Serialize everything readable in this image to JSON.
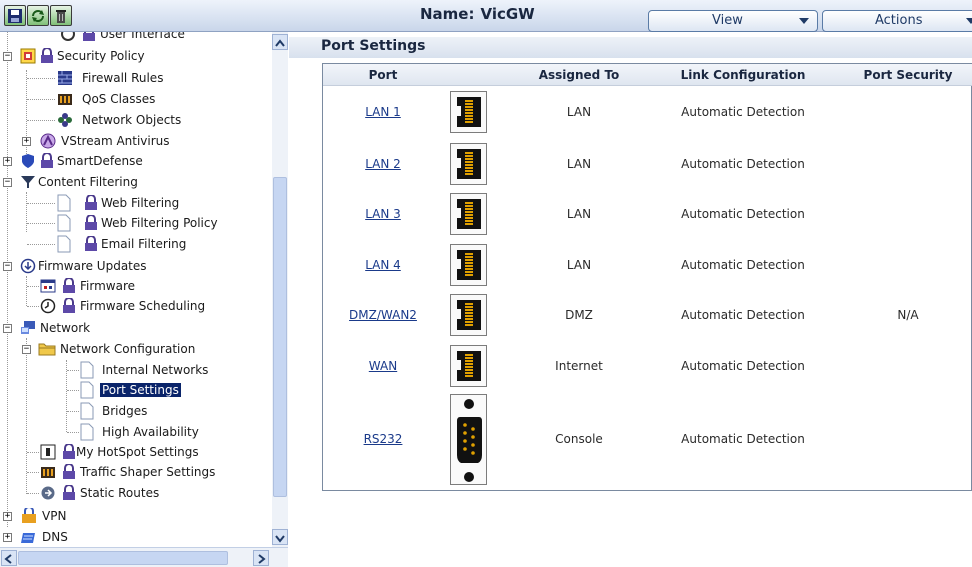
{
  "header": {
    "name_label": "Name:",
    "name_value": "VicGW",
    "view_label": "View",
    "actions_label": "Actions",
    "toolbar_icons": [
      "save-icon",
      "refresh-icon",
      "delete-icon"
    ]
  },
  "tree": {
    "items": [
      {
        "label": "User Interface",
        "icon": "user-interface-icon",
        "locked": true
      },
      {
        "label": "Security Policy",
        "icon": "security-policy-icon",
        "locked": true
      },
      {
        "label": "Firewall Rules",
        "icon": "firewall-icon",
        "locked": false
      },
      {
        "label": "QoS Classes",
        "icon": "qos-icon",
        "locked": false
      },
      {
        "label": "Network Objects",
        "icon": "network-objects-icon",
        "locked": false
      },
      {
        "label": "VStream Antivirus",
        "icon": "antivirus-icon",
        "locked": false
      },
      {
        "label": "SmartDefense",
        "icon": "shield-icon",
        "locked": true
      },
      {
        "label": "Content Filtering",
        "icon": "filter-icon",
        "locked": false
      },
      {
        "label": "Web Filtering",
        "icon": "page-icon",
        "locked": true
      },
      {
        "label": "Web Filtering Policy",
        "icon": "page-icon",
        "locked": true
      },
      {
        "label": "Email Filtering",
        "icon": "page-icon",
        "locked": true
      },
      {
        "label": "Firmware Updates",
        "icon": "download-icon",
        "locked": false
      },
      {
        "label": "Firmware",
        "icon": "firmware-icon",
        "locked": true
      },
      {
        "label": "Firmware Scheduling",
        "icon": "clock-icon",
        "locked": true
      },
      {
        "label": "Network",
        "icon": "network-icon",
        "locked": false
      },
      {
        "label": "Network Configuration",
        "icon": "folder-icon",
        "locked": false
      },
      {
        "label": "Internal Networks",
        "icon": "page-icon",
        "locked": false
      },
      {
        "label": "Port Settings",
        "icon": "page-icon",
        "locked": false,
        "selected": true
      },
      {
        "label": "Bridges",
        "icon": "page-icon",
        "locked": false
      },
      {
        "label": "High Availability",
        "icon": "page-icon",
        "locked": false
      },
      {
        "label": "My HotSpot Settings",
        "icon": "hotspot-icon",
        "locked": true
      },
      {
        "label": "Traffic Shaper Settings",
        "icon": "traffic-shaper-icon",
        "locked": true
      },
      {
        "label": "Static Routes",
        "icon": "routes-icon",
        "locked": true
      },
      {
        "label": "VPN",
        "icon": "vpn-icon",
        "locked": false
      },
      {
        "label": "DNS",
        "icon": "dns-icon",
        "locked": false
      }
    ]
  },
  "main": {
    "section_title": "Port Settings",
    "columns": [
      "Port",
      "Assigned To",
      "Link Configuration",
      "Port Security"
    ],
    "rows": [
      {
        "port": "LAN 1",
        "connector": "rj45-port-icon",
        "assigned": "LAN",
        "link": "Automatic Detection",
        "security": ""
      },
      {
        "port": "LAN 2",
        "connector": "rj45-port-icon",
        "assigned": "LAN",
        "link": "Automatic Detection",
        "security": ""
      },
      {
        "port": "LAN 3",
        "connector": "rj45-port-icon",
        "assigned": "LAN",
        "link": "Automatic Detection",
        "security": ""
      },
      {
        "port": "LAN 4",
        "connector": "rj45-port-icon",
        "assigned": "LAN",
        "link": "Automatic Detection",
        "security": ""
      },
      {
        "port": "DMZ/WAN2",
        "connector": "rj45-port-icon",
        "assigned": "DMZ",
        "link": "Automatic Detection",
        "security": "N/A"
      },
      {
        "port": "WAN",
        "connector": "rj45-port-icon",
        "assigned": "Internet",
        "link": "Automatic Detection",
        "security": ""
      },
      {
        "port": "RS232",
        "connector": "serial-port-icon",
        "assigned": "Console",
        "link": "Automatic Detection",
        "security": ""
      }
    ]
  },
  "colors": {
    "link": "#1a3a8a",
    "selection": "#0a246a",
    "header_text": "#1a2740"
  }
}
